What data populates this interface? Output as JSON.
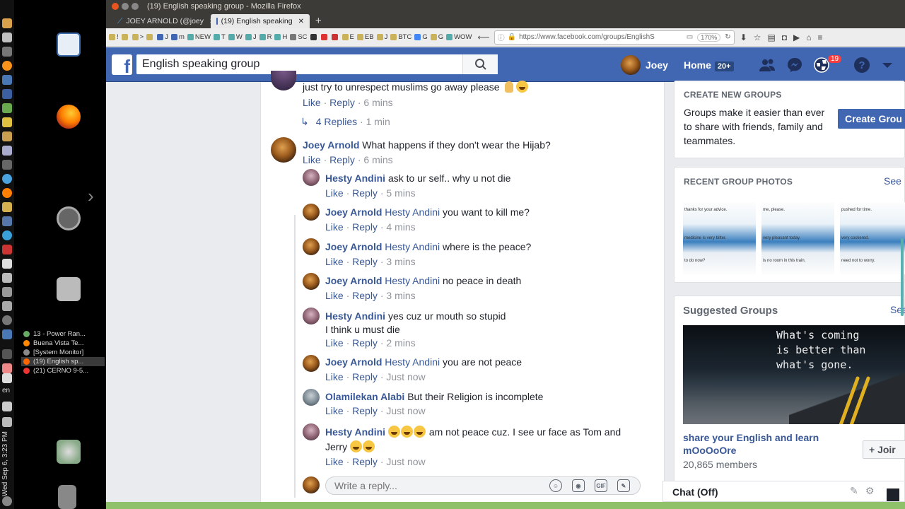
{
  "window": {
    "title": "(19) English speaking group - Mozilla Firefox",
    "tabs": [
      {
        "label": "JOEY ARNOLD (@joey",
        "selected": false
      },
      {
        "label": "(19) English speaking",
        "selected": true
      }
    ]
  },
  "bookmarks": [
    "NEW",
    "T",
    "W",
    "J",
    "R",
    "H",
    "SC",
    "E",
    "EB",
    "J",
    "BTC",
    "G",
    "G",
    "WOW"
  ],
  "urlbar": {
    "url": "https://www.facebook.com/groups/EnglishS",
    "zoom": "170%"
  },
  "taskbar": {
    "clock": "Wed Sep 6, 3:23 PM",
    "lang": "en",
    "windows": [
      {
        "label": "13 - Power Ran...",
        "active": false
      },
      {
        "label": "Buena Vista Te...",
        "active": false
      },
      {
        "label": "[System Monitor]",
        "active": false
      },
      {
        "label": "(19) English sp...",
        "active": true
      },
      {
        "label": "(21) CERNO 9-5...",
        "active": false
      }
    ]
  },
  "fb": {
    "search_value": "English speaking group",
    "user_name": "Joey",
    "home_label": "Home",
    "home_count": "20+",
    "notif_count": "19"
  },
  "feed": {
    "top_comment": {
      "text": "just try to unrespect muslims go away please",
      "like": "Like",
      "reply": "Reply",
      "time": "6 mins",
      "replies_link": "4 Replies",
      "replies_time": "1 min"
    },
    "main_comment": {
      "name": "Joey Arnold",
      "text": "What happens if they don't wear the Hijab?",
      "like": "Like",
      "reply": "Reply",
      "time": "6 mins"
    },
    "replies": [
      {
        "name": "Hesty Andini",
        "tag": "",
        "text": "ask to ur self.. why u not die",
        "time": "5 mins"
      },
      {
        "name": "Joey Arnold",
        "tag": "Hesty Andini",
        "text": "you want to kill me?",
        "time": "4 mins"
      },
      {
        "name": "Joey Arnold",
        "tag": "Hesty Andini",
        "text": "where is the peace?",
        "time": "3 mins"
      },
      {
        "name": "Joey Arnold",
        "tag": "Hesty Andini",
        "text": "no peace in death",
        "time": "3 mins"
      },
      {
        "name": "Hesty Andini",
        "tag": "",
        "text": "yes cuz ur mouth so stupid",
        "text2": "I think u must die",
        "time": "2 mins"
      },
      {
        "name": "Joey Arnold",
        "tag": "Hesty Andini",
        "text": "you are not peace",
        "time": "Just now"
      },
      {
        "name": "Olamilekan Alabi",
        "tag": "",
        "text": "But their Religion is incomplete",
        "time": "Just now"
      },
      {
        "name": "Hesty Andini",
        "tag": "",
        "text": "am not peace cuz. I see ur face as Tom and",
        "text2": "Jerry",
        "time": "Just now"
      }
    ],
    "like_label": "Like",
    "reply_label": "Reply",
    "reply_placeholder": "Write a reply..."
  },
  "sidebar": {
    "create_title": "CREATE NEW GROUPS",
    "create_text": "Groups make it easier than ever to share with friends, family and teammates.",
    "create_button": "Create Grou",
    "photos_title": "RECENT GROUP PHOTOS",
    "see_label": "See",
    "photos": [
      {
        "line1": "thanks for your advice.",
        "line2": "medicine is very bitter.",
        "line3": "to do now?"
      },
      {
        "line1": "me, please.",
        "line2": "very pleasant today.",
        "line3": "is no room in this train."
      },
      {
        "line1": "pushed for time.",
        "line2": "very cockered.",
        "line3": "need not to worry."
      }
    ],
    "suggested_title": "Suggested Groups",
    "suggested_quote": "What's coming\nis better than\nwhat's gone.",
    "suggested_name": "share your English and learn mOoOoOre",
    "suggested_members": "20,865 members",
    "join_label": "+ Joir",
    "chat_label": "Chat (Off)"
  }
}
